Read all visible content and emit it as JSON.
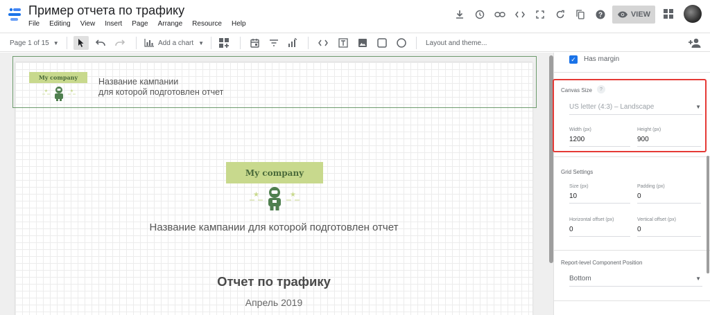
{
  "app": {
    "title": "Пример отчета по трафику",
    "menu": [
      "File",
      "Editing",
      "View",
      "Insert",
      "Page",
      "Arrange",
      "Resource",
      "Help"
    ],
    "view_label": "VIEW",
    "icons": [
      "download-icon",
      "history-icon",
      "link-icon",
      "embed-code-icon",
      "fullscreen-icon",
      "refresh-icon",
      "copy-icon",
      "help-icon"
    ]
  },
  "toolbar": {
    "page_indicator": "Page 1 of 15",
    "add_chart": "Add a chart",
    "layout_theme": "Layout and theme..."
  },
  "report": {
    "header_logo": "My company",
    "header_text_line1": "Название кампании",
    "header_text_line2": "для которой подготовлен отчет",
    "main_logo": "My company",
    "campaign_line": "Название кампании для которой подготовлен отчет",
    "title": "Отчет по трафику",
    "date": "Апрель 2019"
  },
  "panel": {
    "has_margin_label": "Has margin",
    "has_margin_checked": true,
    "canvas_size": {
      "title": "Canvas Size",
      "help": "?",
      "preset": "US letter (4:3) – Landscape",
      "width_label": "Width (px)",
      "width_value": "1200",
      "height_label": "Height (px)",
      "height_value": "900"
    },
    "grid_settings": {
      "title": "Grid Settings",
      "size_label": "Size (px)",
      "size_value": "10",
      "padding_label": "Padding (px)",
      "padding_value": "0",
      "h_offset_label": "Horizontal offset (px)",
      "h_offset_value": "0",
      "v_offset_label": "Vertical offset (px)",
      "v_offset_value": "0"
    },
    "component_position": {
      "title": "Report-level Component Position",
      "value": "Bottom"
    }
  },
  "colors": {
    "accent_blue": "#1a73e8",
    "logo_green": "#c8d98d",
    "astronaut_green": "#4f7f4f",
    "highlight_red": "#e53935",
    "header_border": "#6c9a6c"
  }
}
